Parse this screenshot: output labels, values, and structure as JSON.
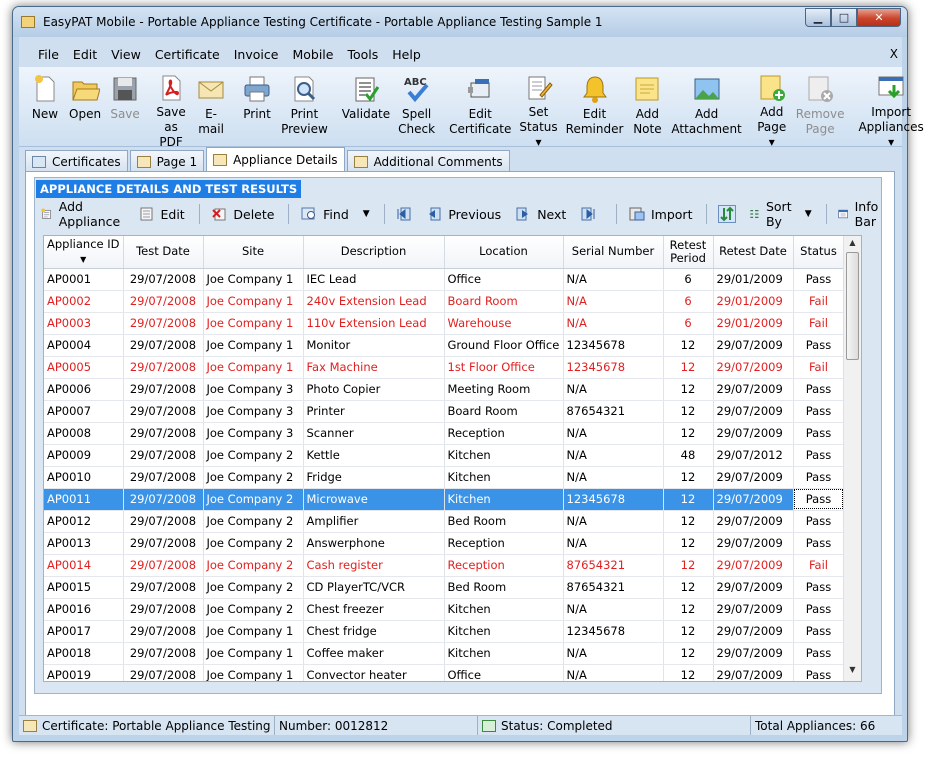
{
  "window": {
    "title": "EasyPAT Mobile - Portable Appliance Testing Certificate - Portable Appliance Testing Sample 1"
  },
  "menu": [
    "File",
    "Edit",
    "View",
    "Certificate",
    "Invoice",
    "Mobile",
    "Tools",
    "Help"
  ],
  "menu_close": "X",
  "toolbar": [
    {
      "l1": "New",
      "l2": "",
      "icon": "new-document-icon",
      "disabled": false
    },
    {
      "l1": "Open",
      "l2": "",
      "icon": "open-folder-icon",
      "disabled": false
    },
    {
      "l1": "Save",
      "l2": "",
      "icon": "save-disk-icon",
      "disabled": true
    },
    {
      "l1": "Save",
      "l2": "as PDF",
      "icon": "pdf-icon",
      "disabled": false
    },
    {
      "l1": "E-mail",
      "l2": "",
      "icon": "envelope-icon",
      "disabled": false
    },
    {
      "l1": "Print",
      "l2": "",
      "icon": "printer-icon",
      "disabled": false
    },
    {
      "l1": "Print",
      "l2": "Preview",
      "icon": "print-preview-icon",
      "disabled": false
    },
    {
      "l1": "Validate",
      "l2": "",
      "icon": "checklist-icon",
      "disabled": false
    },
    {
      "l1": "Spell",
      "l2": "Check",
      "icon": "spell-check-icon",
      "disabled": false
    },
    {
      "l1": "Edit",
      "l2": "Certificate",
      "icon": "edit-certificate-icon",
      "disabled": false
    },
    {
      "l1": "Set",
      "l2": "Status ▾",
      "icon": "set-status-icon",
      "disabled": false
    },
    {
      "l1": "Edit",
      "l2": "Reminder",
      "icon": "bell-icon",
      "disabled": false
    },
    {
      "l1": "Add",
      "l2": "Note",
      "icon": "note-icon",
      "disabled": false
    },
    {
      "l1": "Add",
      "l2": "Attachment",
      "icon": "picture-icon",
      "disabled": false
    },
    {
      "l1": "Add",
      "l2": "Page ▾",
      "icon": "add-page-icon",
      "disabled": false
    },
    {
      "l1": "Remove",
      "l2": "Page",
      "icon": "remove-page-icon",
      "disabled": true
    },
    {
      "l1": "Import",
      "l2": "Appliances ▾",
      "icon": "import-icon",
      "disabled": false
    }
  ],
  "tabs": [
    "Certificates",
    "Page 1",
    "Appliance Details",
    "Additional Comments"
  ],
  "section_heading": "APPLIANCE DETAILS AND TEST RESULTS",
  "grid_toolbar": {
    "add": "Add Appliance",
    "edit": "Edit",
    "delete": "Delete",
    "find": "Find",
    "previous": "Previous",
    "next": "Next",
    "import": "Import",
    "sort": "Sort By",
    "infobar": "Info Bar"
  },
  "columns": [
    "Appliance ID",
    "Test Date",
    "Site",
    "Description",
    "Location",
    "Serial Number",
    "Retest Period",
    "Retest Date",
    "Status"
  ],
  "rows": [
    [
      "AP0001",
      "29/07/2008",
      "Joe Company 1",
      "IEC Lead",
      "Office",
      "N/A",
      "6",
      "29/01/2009",
      "Pass"
    ],
    [
      "AP0002",
      "29/07/2008",
      "Joe Company 1",
      "240v Extension Lead",
      "Board Room",
      "N/A",
      "6",
      "29/01/2009",
      "Fail"
    ],
    [
      "AP0003",
      "29/07/2008",
      "Joe Company 1",
      "110v Extension Lead",
      "Warehouse",
      "N/A",
      "6",
      "29/01/2009",
      "Fail"
    ],
    [
      "AP0004",
      "29/07/2008",
      "Joe Company 1",
      "Monitor",
      "Ground Floor Office",
      "12345678",
      "12",
      "29/07/2009",
      "Pass"
    ],
    [
      "AP0005",
      "29/07/2008",
      "Joe Company 1",
      "Fax Machine",
      "1st Floor Office",
      "12345678",
      "12",
      "29/07/2009",
      "Fail"
    ],
    [
      "AP0006",
      "29/07/2008",
      "Joe Company 3",
      "Photo Copier",
      "Meeting Room",
      "N/A",
      "12",
      "29/07/2009",
      "Pass"
    ],
    [
      "AP0007",
      "29/07/2008",
      "Joe Company 3",
      "Printer",
      "Board Room",
      "87654321",
      "12",
      "29/07/2009",
      "Pass"
    ],
    [
      "AP0008",
      "29/07/2008",
      "Joe Company 3",
      "Scanner",
      "Reception",
      "N/A",
      "12",
      "29/07/2009",
      "Pass"
    ],
    [
      "AP0009",
      "29/07/2008",
      "Joe Company 2",
      "Kettle",
      "Kitchen",
      "N/A",
      "48",
      "29/07/2012",
      "Pass"
    ],
    [
      "AP0010",
      "29/07/2008",
      "Joe Company 2",
      "Fridge",
      "Kitchen",
      "N/A",
      "12",
      "29/07/2009",
      "Pass"
    ],
    [
      "AP0011",
      "29/07/2008",
      "Joe Company 2",
      "Microwave",
      "Kitchen",
      "12345678",
      "12",
      "29/07/2009",
      "Pass"
    ],
    [
      "AP0012",
      "29/07/2008",
      "Joe Company 2",
      "Amplifier",
      "Bed Room",
      "N/A",
      "12",
      "29/07/2009",
      "Pass"
    ],
    [
      "AP0013",
      "29/07/2008",
      "Joe Company 2",
      "Answerphone",
      "Reception",
      "N/A",
      "12",
      "29/07/2009",
      "Pass"
    ],
    [
      "AP0014",
      "29/07/2008",
      "Joe Company 2",
      "Cash register",
      "Reception",
      "87654321",
      "12",
      "29/07/2009",
      "Fail"
    ],
    [
      "AP0015",
      "29/07/2008",
      "Joe Company 2",
      "CD PlayerTC/VCR",
      "Bed Room",
      "87654321",
      "12",
      "29/07/2009",
      "Pass"
    ],
    [
      "AP0016",
      "29/07/2008",
      "Joe Company 2",
      "Chest freezer",
      "Kitchen",
      "N/A",
      "12",
      "29/07/2009",
      "Pass"
    ],
    [
      "AP0017",
      "29/07/2008",
      "Joe Company 1",
      "Chest fridge",
      "Kitchen",
      "12345678",
      "12",
      "29/07/2009",
      "Pass"
    ],
    [
      "AP0018",
      "29/07/2008",
      "Joe Company 1",
      "Coffee maker",
      "Kitchen",
      "N/A",
      "12",
      "29/07/2009",
      "Pass"
    ],
    [
      "AP0019",
      "29/07/2008",
      "Joe Company 1",
      "Convector heater",
      "Office",
      "N/A",
      "12",
      "29/07/2009",
      "Pass"
    ]
  ],
  "selected_row_index": 10,
  "status_bar": {
    "certificate": "Certificate: Portable Appliance Testing Certi",
    "number": "Number: 0012812",
    "status": "Status: Completed",
    "total": "Total Appliances: 66"
  },
  "colors": {
    "fail": "#e02020",
    "selection": "#3a93e6",
    "section_heading": "#1f7de6"
  }
}
